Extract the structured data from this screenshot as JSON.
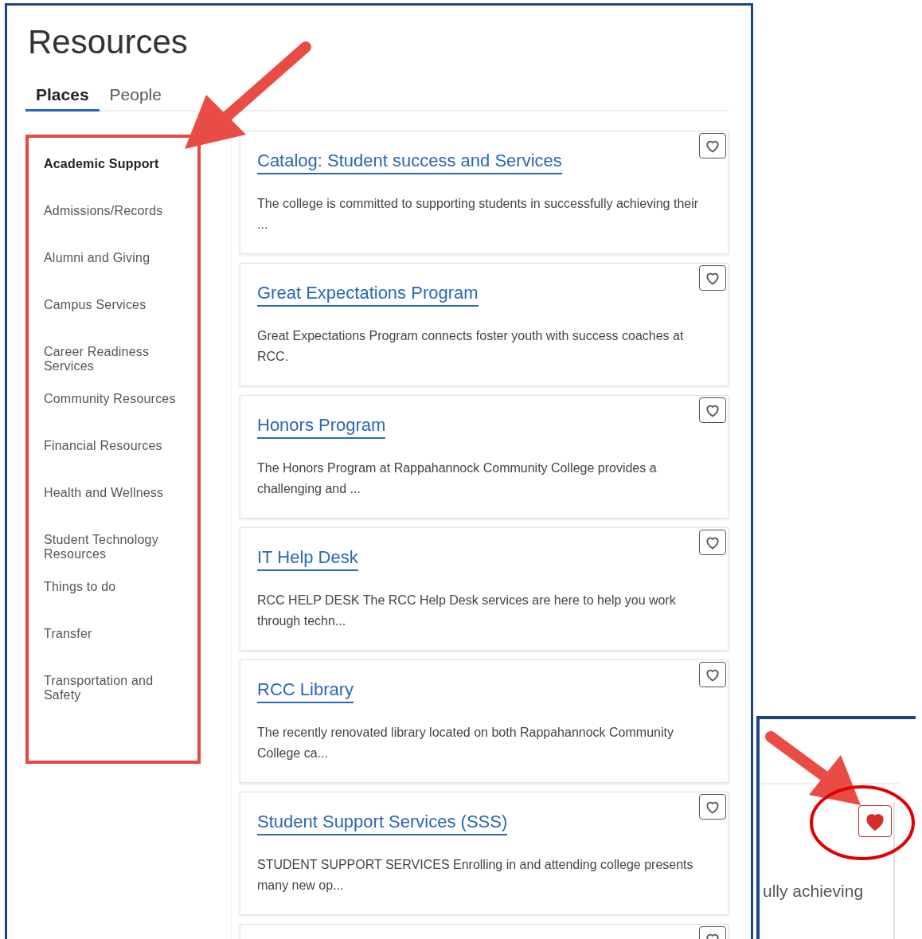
{
  "title": "Resources",
  "tabs": [
    {
      "label": "Places",
      "selected": true
    },
    {
      "label": "People",
      "selected": false
    }
  ],
  "categories": [
    {
      "label": "Academic Support",
      "selected": true
    },
    {
      "label": "Admissions/Records",
      "selected": false
    },
    {
      "label": "Alumni and Giving",
      "selected": false
    },
    {
      "label": "Campus Services",
      "selected": false
    },
    {
      "label": "Career Readiness Services",
      "selected": false
    },
    {
      "label": "Community Resources",
      "selected": false
    },
    {
      "label": "Financial Resources",
      "selected": false
    },
    {
      "label": "Health and Wellness",
      "selected": false
    },
    {
      "label": "Student Technology Resources",
      "selected": false
    },
    {
      "label": "Things to do",
      "selected": false
    },
    {
      "label": "Transfer",
      "selected": false
    },
    {
      "label": "Transportation and Safety",
      "selected": false
    }
  ],
  "resources": [
    {
      "title": "Catalog: Student success and Services",
      "description": "The college is committed to supporting students in successfully achieving their ...",
      "favorited": false
    },
    {
      "title": "Great Expectations Program",
      "description": "Great Expectations Program connects foster youth with success coaches at RCC.",
      "favorited": false
    },
    {
      "title": "Honors Program",
      "description": "The Honors Program at Rappahannock Community College provides a challenging and ...",
      "favorited": false
    },
    {
      "title": "IT Help Desk",
      "description": "RCC HELP DESK The RCC Help Desk services are here to help you work through techn...",
      "favorited": false
    },
    {
      "title": "RCC Library",
      "description": "The recently renovated library located on both Rappahannock Community College ca...",
      "favorited": false
    },
    {
      "title": "Student Support Services (SSS)",
      "description": "STUDENT SUPPORT SERVICES Enrolling in and attending college presents many new op...",
      "favorited": false
    },
    {
      "favorited": false
    }
  ],
  "inset": {
    "description": "ully achieving",
    "favorited": true
  }
}
